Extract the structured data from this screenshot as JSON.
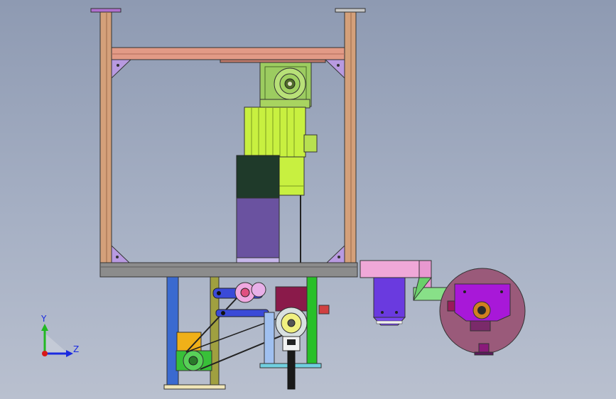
{
  "viewport": {
    "background": "#9aa5bc"
  },
  "triad": {
    "y_label": "Y",
    "z_label": "Z",
    "y_color": "#22b822",
    "z_color": "#1a2ae0",
    "origin_color": "#d81818"
  },
  "colors": {
    "frame": "#d4a07a",
    "crossbar": "#e29a86",
    "gusset": "#b89ae0",
    "gearbox": "#9ccc60",
    "motor": "#c8f040",
    "dark_block": "#1f3a2a",
    "purple_block": "#6a52a0",
    "base_plate": "#8c8c8c",
    "pink_duct": "#f0a8d8",
    "green_duct": "#88e088",
    "disk": "#9a5a7a",
    "magenta_plate": "#a818d8",
    "blue_bracket": "#6a3adf"
  }
}
